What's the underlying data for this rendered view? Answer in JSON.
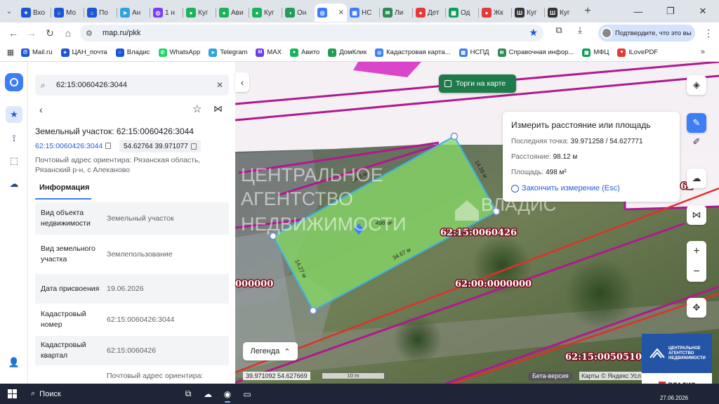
{
  "browser": {
    "tabs": [
      {
        "title": "Вхо",
        "color": "#1a56d6",
        "glyph": "✦"
      },
      {
        "title": "Мо",
        "color": "#1a56d6",
        "glyph": "⌂"
      },
      {
        "title": "По",
        "color": "#1a56d6",
        "glyph": "⌂"
      },
      {
        "title": "Ан",
        "color": "#2ea3e0",
        "glyph": "➤"
      },
      {
        "title": "1 н",
        "color": "#7b3ff2",
        "glyph": "◎"
      },
      {
        "title": "Куг",
        "color": "#19b35a",
        "glyph": "●"
      },
      {
        "title": "Ави",
        "color": "#19b35a",
        "glyph": "●"
      },
      {
        "title": "Куг",
        "color": "#19b35a",
        "glyph": "●"
      },
      {
        "title": "Он",
        "color": "#1f9d55",
        "glyph": "◑"
      },
      {
        "title": "",
        "color": "#3d7ef5",
        "glyph": "◎",
        "active": true
      },
      {
        "title": "НС",
        "color": "#3d7ef5",
        "glyph": "▦"
      },
      {
        "title": "Ли",
        "color": "#2e8b57",
        "glyph": "✉"
      },
      {
        "title": "Дет",
        "color": "#e53935",
        "glyph": "●"
      },
      {
        "title": "Од",
        "color": "#0f9d58",
        "glyph": "▦"
      },
      {
        "title": "Жк",
        "color": "#e53935",
        "glyph": "●"
      },
      {
        "title": "Куг",
        "color": "#333333",
        "glyph": "Ш"
      },
      {
        "title": "Куг",
        "color": "#333333",
        "glyph": "Ш"
      }
    ],
    "url": "map.ru/pkk",
    "profile_text": "Подтвердите, что это вы",
    "bookmarks": [
      {
        "label": "Mail.ru",
        "color": "#1a56d6",
        "glyph": "@"
      },
      {
        "label": "ЦАН_почта",
        "color": "#1a56d6",
        "glyph": "✦"
      },
      {
        "label": "Владис",
        "color": "#1a56d6",
        "glyph": "⌂"
      },
      {
        "label": "WhatsApp",
        "color": "#25d366",
        "glyph": "✆"
      },
      {
        "label": "Telegram",
        "color": "#2ea3e0",
        "glyph": "➤"
      },
      {
        "label": "MAX",
        "color": "#6a3ef2",
        "glyph": "M"
      },
      {
        "label": "Авито",
        "color": "#19b35a",
        "glyph": "●"
      },
      {
        "label": "ДомКлик",
        "color": "#1f9d55",
        "glyph": "◑"
      },
      {
        "label": "Кадастровая карта...",
        "color": "#3d7ef5",
        "glyph": "◎"
      },
      {
        "label": "НСПД",
        "color": "#3d7ef5",
        "glyph": "▦"
      },
      {
        "label": "Справочная инфор...",
        "color": "#2e8b57",
        "glyph": "✉"
      },
      {
        "label": "МФЦ",
        "color": "#0f9d58",
        "glyph": "▦"
      },
      {
        "label": "iLovePDF",
        "color": "#e53935",
        "glyph": "♥"
      }
    ]
  },
  "panel": {
    "search_value": "62:15:0060426:3044",
    "title": "Земельный участок: 62:15:0060426:3044",
    "cadastral_link": "62:15:0060426:3044",
    "coords": "54.62764 39.971077",
    "address": "Почтовый адрес ориентира: Рязанская область, Рязанский р-н, с Алеканово",
    "tab_label": "Информация",
    "rows": [
      {
        "key": "Вид объекта недвижимости",
        "value": "Земельный участок"
      },
      {
        "key": "Вид земельного участка",
        "value": "Землепользование"
      },
      {
        "key": "Дата присвоения",
        "value": "19.06.2026"
      },
      {
        "key": "Кадастровый номер",
        "value": "62:15:0060426:3044"
      },
      {
        "key": "Кадастровый квартал",
        "value": "62:15:0060426"
      },
      {
        "key": "",
        "value": "Почтовый адрес ориентира:"
      }
    ]
  },
  "map": {
    "torgi_label": "Торги на карте",
    "measure": {
      "title": "Измерить расстояние или площадь",
      "last_point_label": "Последняя точка:",
      "last_point_value": "39.971258 / 54.627771",
      "distance_label": "Расстояние:",
      "distance_value": "98.12 м",
      "area_label": "Площадь:",
      "area_value": "498 м²",
      "finish_label": "Закончить измерение (Esc)"
    },
    "watermark_1": "ЦЕНТРАЛЬНОЕ",
    "watermark_2": "АГЕНТСТВО",
    "watermark_3": "НЕДВИЖИМОСТИ",
    "watermark_brand": "ВЛАДИС",
    "labels": {
      "quarter_1": "62:15:0060426",
      "quarter_2": "62:00:0000000",
      "quarter_3": "62:15:0050510",
      "left_zero": "000000",
      "right_edge": "62"
    },
    "edges": {
      "top": "34.3 м",
      "right": "14.39 м",
      "bottom": "34.67 м",
      "left": "14.27 м",
      "center_area": "498 м²"
    },
    "legend_label": "Легенда",
    "cursor_coords": "39.971092   54.627669",
    "scale_label": "10 m",
    "beta_label": "Бета-версия",
    "attribution": "Карты © Яндекс  Усл",
    "brand_block": {
      "line1": "ЦЕНТРАЛЬНОЕ",
      "line2": "АГЕНТСТВО",
      "line3": "НЕДВИЖИМОСТИ",
      "name": "ВЛАДИС"
    }
  },
  "taskbar": {
    "search_label": "Поиск",
    "clock_date": "27.06.2026"
  },
  "colors": {
    "accent": "#3d7ef5",
    "boundary_magenta": "#b0198f",
    "boundary_red": "#e0302b",
    "parcel_fill": "#86d867",
    "torgi_green": "#1f7a4a"
  }
}
